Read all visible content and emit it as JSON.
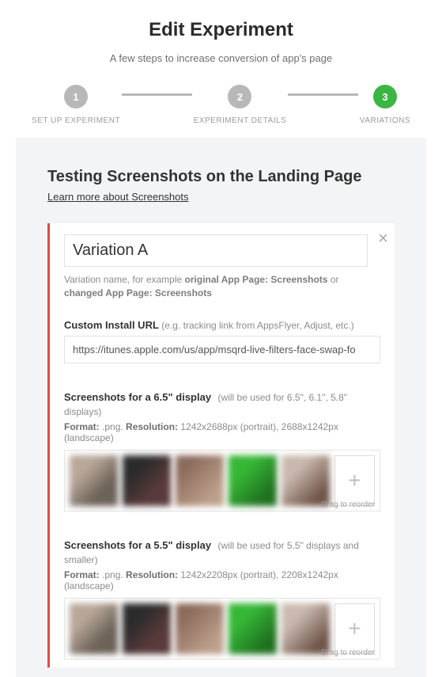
{
  "header": {
    "title": "Edit Experiment",
    "subtitle": "A few steps to increase conversion of app's page"
  },
  "stepper": {
    "steps": [
      {
        "num": "1",
        "label": "SET UP EXPERIMENT"
      },
      {
        "num": "2",
        "label": "EXPERIMENT DETAILS"
      },
      {
        "num": "3",
        "label": "VARIATIONS"
      }
    ]
  },
  "section": {
    "title": "Testing Screenshots on the Landing Page",
    "learn": "Learn more about Screenshots"
  },
  "variation": {
    "name": "Variation A",
    "hint_pre": "Variation name, for example ",
    "hint_b1": "original App Page: Screenshots",
    "hint_mid": " or ",
    "hint_b2": "changed App Page: Screenshots",
    "url_label": "Custom Install URL",
    "url_hint": "(e.g. tracking link from AppsFlyer, Adjust, etc.)",
    "url_value": "https://itunes.apple.com/us/app/msqrd-live-filters-face-swap-fo",
    "close": "×"
  },
  "ss1": {
    "title": "Screenshots for a 6.5\" display",
    "note": "(will be used for 6.5\", 6.1\", 5.8\" displays)",
    "format_label": "Format:",
    "format_val": " .png. ",
    "res_label": "Resolution:",
    "res_val": " 1242x2688px (portrait), 2688x1242px (landscape)",
    "drag": "Drag to reorder",
    "add": "+"
  },
  "ss2": {
    "title": "Screenshots for a 5.5\" display",
    "note": "(will be used for 5.5\" displays and smaller)",
    "format_label": "Format:",
    "format_val": " .png. ",
    "res_label": "Resolution:",
    "res_val": " 1242x2208px (portrait), 2208x1242px (landscape)",
    "drag": "Drag to reorder",
    "add": "+"
  }
}
